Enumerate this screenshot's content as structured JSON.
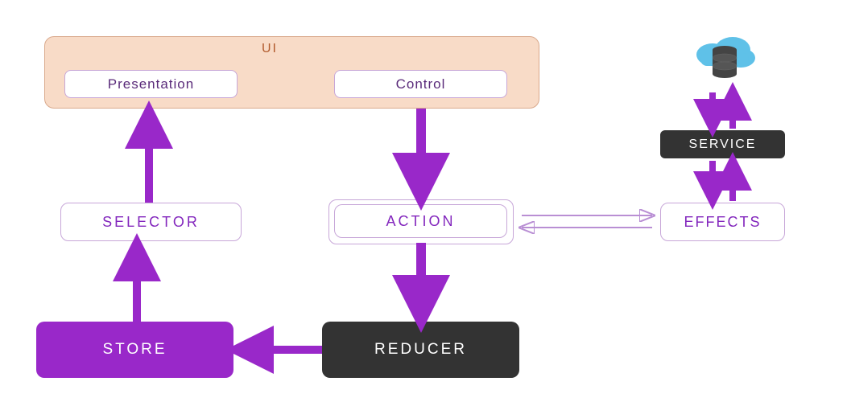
{
  "ui": {
    "title": "UI",
    "presentation": "Presentation",
    "control": "Control"
  },
  "nodes": {
    "selector": "SELECTOR",
    "action": "ACTION",
    "store": "STORE",
    "reducer": "REDUCER",
    "service": "SERVICE",
    "effects": "EFFECTS"
  },
  "colors": {
    "purple": "#9928c9",
    "purpleText": "#8327bd",
    "dark": "#333333",
    "uiBg": "#f8dbc7",
    "cloud": "#5fc1e8"
  }
}
